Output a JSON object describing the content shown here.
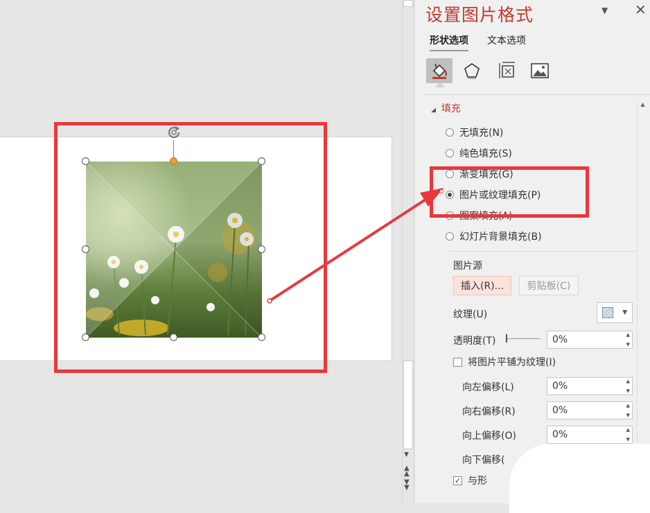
{
  "pane": {
    "title": "设置图片格式",
    "dropdown_icon": "chevron-down-icon",
    "close_icon": "close-icon",
    "tabs": [
      {
        "label": "形状选项",
        "active": true
      },
      {
        "label": "文本选项",
        "active": false
      }
    ],
    "tool_icons": [
      "fill-line-icon",
      "effects-icon",
      "size-properties-icon",
      "picture-icon"
    ],
    "section_header": "填充",
    "fill_options": [
      {
        "label": "无填充(N)",
        "selected": false
      },
      {
        "label": "纯色填充(S)",
        "selected": false
      },
      {
        "label": "渐变填充(G)",
        "selected": false
      },
      {
        "label": "图片或纹理填充(P)",
        "selected": true
      },
      {
        "label": "图案填充(A)",
        "selected": false
      },
      {
        "label": "幻灯片背景填充(B)",
        "selected": false
      }
    ],
    "picture_source_label": "图片源",
    "insert_button": "插入(R)...",
    "clipboard_button": "剪贴板(C)",
    "texture_label": "纹理(U)",
    "transparency_label": "透明度(T)",
    "transparency_value": "0%",
    "tile_checkbox_label": "将图片平铺为纹理(I)",
    "tile_checked": false,
    "offsets": [
      {
        "label": "向左偏移(L)",
        "value": "0%"
      },
      {
        "label": "向右偏移(R)",
        "value": "0%"
      },
      {
        "label": "向上偏移(O)",
        "value": "0%"
      },
      {
        "label": "向下偏移(",
        "value": ""
      }
    ],
    "rotate_checkbox_label": "与形",
    "rotate_checked": true
  },
  "colors": {
    "accent": "#c0392b",
    "annotation_red": "#e8383d",
    "insert_button_bg": "#fbe3dc"
  }
}
